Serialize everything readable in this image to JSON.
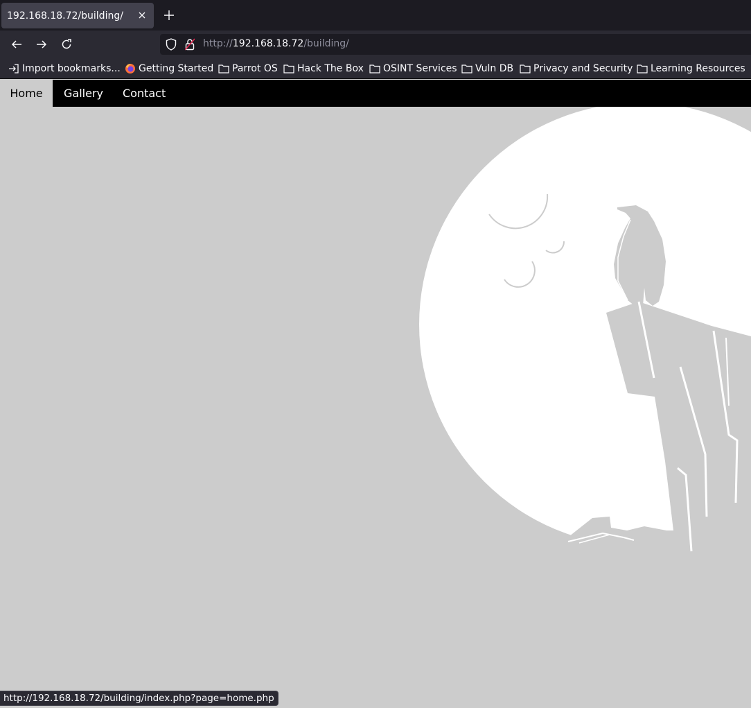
{
  "browser": {
    "tab": {
      "title": "192.168.18.72/building/"
    },
    "address": {
      "scheme": "http://",
      "host": "192.168.18.72",
      "path": "/building/"
    },
    "bookmarks": [
      {
        "label": "Import bookmarks...",
        "icon": "import-icon"
      },
      {
        "label": "Getting Started",
        "icon": "firefox-icon"
      },
      {
        "label": "Parrot OS",
        "icon": "folder-icon"
      },
      {
        "label": "Hack The Box",
        "icon": "folder-icon"
      },
      {
        "label": "OSINT Services",
        "icon": "folder-icon"
      },
      {
        "label": "Vuln DB",
        "icon": "folder-icon"
      },
      {
        "label": "Privacy and Security",
        "icon": "folder-icon"
      },
      {
        "label": "Learning Resources",
        "icon": "folder-icon"
      }
    ],
    "status_url": "http://192.168.18.72/building/index.php?page=home.php"
  },
  "site": {
    "nav": [
      {
        "label": "Home",
        "active": true
      },
      {
        "label": "Gallery",
        "active": false
      },
      {
        "label": "Contact",
        "active": false
      }
    ],
    "hero_image": "penguin-on-cliff-moon-illustration"
  },
  "colors": {
    "page_background": "#cccccc",
    "nav_background": "#000000",
    "nav_active": "#cccccc",
    "moon": "#ffffff",
    "chrome_dark": "#1c1b22",
    "chrome": "#2b2a33"
  }
}
